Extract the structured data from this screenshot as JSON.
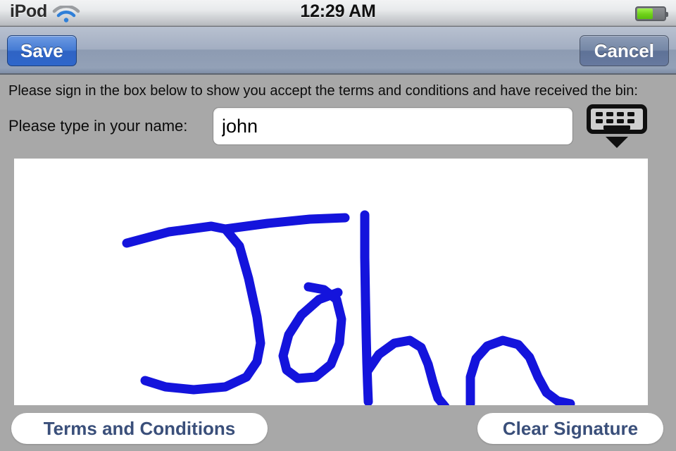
{
  "status_bar": {
    "carrier": "iPod",
    "wifi_icon": "wifi-icon",
    "time": "12:29 AM",
    "battery_icon": "battery-icon",
    "battery_level_percent": 58
  },
  "toolbar": {
    "save_label": "Save",
    "cancel_label": "Cancel",
    "save_color": "#2f63c4",
    "cancel_color": "#5e7297"
  },
  "content": {
    "instruction": "Please sign in the box below to show you accept the terms and conditions and have received the bin:",
    "name_label": "Please type in your name:",
    "name_value": "john",
    "name_placeholder": "",
    "keyboard_dismiss_icon": "keyboard-dismiss-icon",
    "signature": {
      "ink_color": "#1414dc",
      "stroke_width": 13,
      "alt_text": "John",
      "strokes": [
        "M 160 120 L 220 104 L 280 96 L 300 100 L 320 124 L 333 170 L 345 225 L 350 262 L 345 288 L 330 310 L 300 324 L 255 328 L 215 324 L 186 315",
        "M 300 100 L 360 92 L 420 86 L 470 84",
        "M 460 190 L 433 200 L 408 222 L 390 250 L 382 280 L 387 300 L 403 312 L 428 310 L 450 292 L 462 262 L 465 228 L 458 200 L 440 186 L 418 182",
        "M 498 80 L 498 140 L 499 200 L 500 250 L 501 290 L 502 320 L 503 345",
        "M 503 300 L 518 278 L 540 262 L 562 258 L 578 268 L 588 292 L 595 318 L 602 340 L 612 352",
        "M 648 348 L 648 310 L 656 284 L 672 266 L 694 258 L 716 264 L 732 282 L 744 310 L 756 332 L 772 344 L 790 348"
      ]
    }
  },
  "bottom_bar": {
    "terms_label": "Terms and Conditions",
    "clear_label": "Clear Signature"
  }
}
